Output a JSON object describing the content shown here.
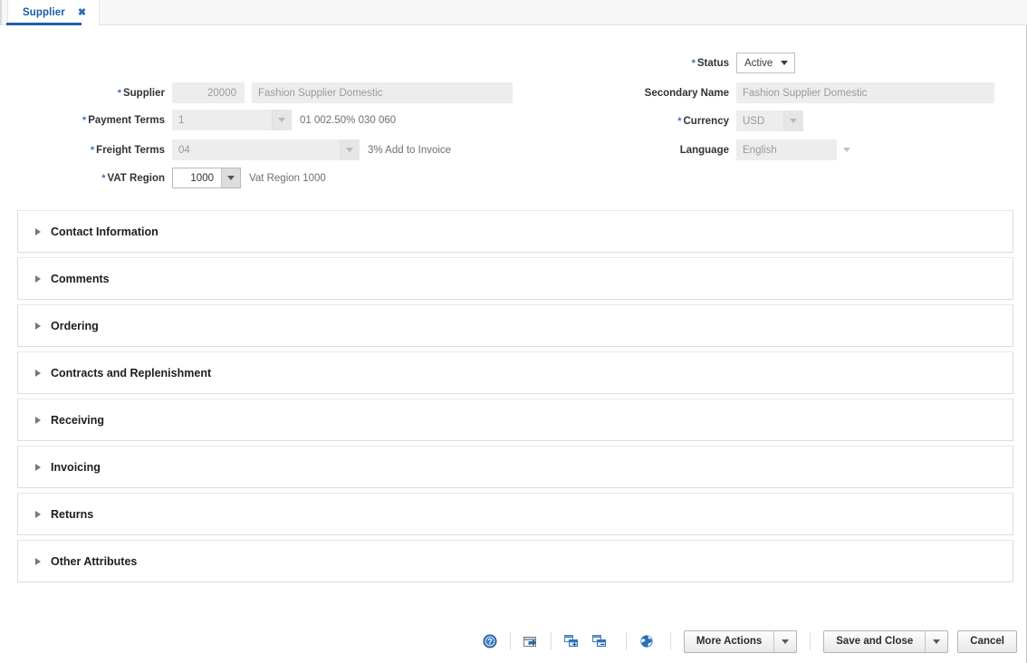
{
  "tab": {
    "label": "Supplier",
    "close_icon": "close-icon",
    "close_glyph": "✖"
  },
  "form": {
    "left": [
      {
        "label": "Supplier",
        "required": true,
        "value": "20000",
        "secondary_value": "Fashion Supplier Domestic",
        "readonly": true,
        "type": "text-pair"
      },
      {
        "label": "Payment Terms",
        "required": true,
        "value": "1",
        "hint": "01 002.50% 030 060",
        "readonly": true,
        "type": "combo"
      },
      {
        "label": "Freight Terms",
        "required": true,
        "value": "04",
        "hint": "3% Add to Invoice",
        "readonly": true,
        "type": "combo"
      },
      {
        "label": "VAT Region",
        "required": true,
        "value": "1000",
        "hint": "Vat Region 1000",
        "readonly": false,
        "type": "combo"
      }
    ],
    "right": [
      {
        "label": "Status",
        "required": true,
        "value": "Active",
        "readonly": false,
        "type": "select"
      },
      {
        "label": "Secondary Name",
        "required": false,
        "value": "Fashion Supplier Domestic",
        "readonly": true,
        "type": "text"
      },
      {
        "label": "Currency",
        "required": true,
        "value": "USD",
        "readonly": true,
        "type": "combo"
      },
      {
        "label": "Language",
        "required": false,
        "value": "English",
        "readonly": true,
        "type": "combo"
      }
    ]
  },
  "panels": [
    {
      "title": "Contact Information",
      "expanded": false
    },
    {
      "title": "Comments",
      "expanded": false
    },
    {
      "title": "Ordering",
      "expanded": false
    },
    {
      "title": "Contracts and Replenishment",
      "expanded": false
    },
    {
      "title": "Receiving",
      "expanded": false
    },
    {
      "title": "Invoicing",
      "expanded": false
    },
    {
      "title": "Returns",
      "expanded": false
    },
    {
      "title": "Other Attributes",
      "expanded": false
    }
  ],
  "toolbar": {
    "icons": [
      {
        "name": "help-icon",
        "title": "Help"
      },
      {
        "name": "open-in-window-icon",
        "title": "Open"
      },
      {
        "name": "expand-all-icon",
        "title": "Expand All"
      },
      {
        "name": "collapse-all-icon",
        "title": "Collapse All"
      },
      {
        "name": "translate-globe-icon",
        "title": "Translate"
      }
    ],
    "more_actions_label": "More Actions",
    "save_and_close_label": "Save and Close",
    "cancel_label": "Cancel"
  },
  "colors": {
    "accent_blue": "#1f5fa9",
    "tab_text": "#1a5da8",
    "required_marker": "#3b73b9",
    "panel_border": "#d6dde5",
    "field_readonly_bg": "#ededed",
    "icon_blue": "#2a6fb8"
  }
}
